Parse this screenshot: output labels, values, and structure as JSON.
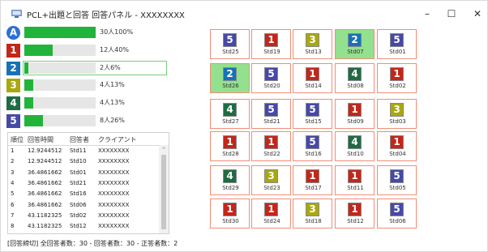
{
  "window": {
    "title": "PCL+出題と回答 回答パネル - XXXXXXXX",
    "controls": {
      "minimize": "–",
      "maximize": "☐",
      "close": "✕"
    }
  },
  "colors": {
    "A": "#2e6fd8",
    "1": "#c3261a",
    "2": "#1672b7",
    "3": "#a8a80f",
    "4": "#1f6b43",
    "5": "#4649a7",
    "bar_fill": "#22b33b",
    "selected_cell": "#93e18e",
    "cell_border": "#f08f78"
  },
  "answers": [
    {
      "label": "A",
      "count_text": "30人100%",
      "percent": 100,
      "circle": true,
      "highlight": false
    },
    {
      "label": "1",
      "count_text": "12人40%",
      "percent": 40,
      "circle": false,
      "highlight": false
    },
    {
      "label": "2",
      "count_text": "2人6%",
      "percent": 6,
      "circle": false,
      "highlight": true
    },
    {
      "label": "3",
      "count_text": "4人13%",
      "percent": 13,
      "circle": false,
      "highlight": false
    },
    {
      "label": "4",
      "count_text": "4人13%",
      "percent": 13,
      "circle": false,
      "highlight": false
    },
    {
      "label": "5",
      "count_text": "8人26%",
      "percent": 26,
      "circle": false,
      "highlight": false
    }
  ],
  "table": {
    "headers": [
      "順位",
      "回答時間",
      "回答者",
      "クライアント"
    ],
    "rows": [
      [
        "1",
        "12.9244512",
        "Std11",
        "XXXXXXXX"
      ],
      [
        "2",
        "12.9244512",
        "Std10",
        "XXXXXXXX"
      ],
      [
        "3",
        "36.4861662",
        "Std01",
        "XXXXXXXX"
      ],
      [
        "4",
        "36.4861662",
        "Std21",
        "XXXXXXXX"
      ],
      [
        "5",
        "36.4861662",
        "Std16",
        "XXXXXXXX"
      ],
      [
        "6",
        "36.4861662",
        "Std06",
        "XXXXXXXX"
      ],
      [
        "7",
        "43.1182325",
        "Std02",
        "XXXXXXXX"
      ],
      [
        "8",
        "43.1182325",
        "Std12",
        "XXXXXXXX"
      ]
    ],
    "scroll_up": "^"
  },
  "status": "[回答締切] 全回答者数：30 - 回答者数：30 - 正答者数：2",
  "grid": [
    [
      {
        "student": "Std25",
        "answer": "5",
        "selected": false
      },
      {
        "student": "Std19",
        "answer": "1",
        "selected": false
      },
      {
        "student": "Std13",
        "answer": "3",
        "selected": false
      },
      {
        "student": "Std07",
        "answer": "2",
        "selected": true
      },
      {
        "student": "Std01",
        "answer": "5",
        "selected": false
      }
    ],
    [
      {
        "student": "Std26",
        "answer": "2",
        "selected": true
      },
      {
        "student": "Std20",
        "answer": "5",
        "selected": false
      },
      {
        "student": "Std14",
        "answer": "1",
        "selected": false
      },
      {
        "student": "Std08",
        "answer": "4",
        "selected": false
      },
      {
        "student": "Std02",
        "answer": "1",
        "selected": false
      }
    ],
    [
      {
        "student": "Std27",
        "answer": "4",
        "selected": false
      },
      {
        "student": "Std21",
        "answer": "5",
        "selected": false
      },
      {
        "student": "Std15",
        "answer": "5",
        "selected": false
      },
      {
        "student": "Std09",
        "answer": "1",
        "selected": false
      },
      {
        "student": "Std03",
        "answer": "3",
        "selected": false
      }
    ],
    [
      {
        "student": "Std28",
        "answer": "1",
        "selected": false
      },
      {
        "student": "Std22",
        "answer": "1",
        "selected": false
      },
      {
        "student": "Std16",
        "answer": "5",
        "selected": false
      },
      {
        "student": "Std10",
        "answer": "4",
        "selected": false
      },
      {
        "student": "Std04",
        "answer": "1",
        "selected": false
      }
    ],
    [
      {
        "student": "Std29",
        "answer": "4",
        "selected": false
      },
      {
        "student": "Std23",
        "answer": "3",
        "selected": false
      },
      {
        "student": "Std17",
        "answer": "1",
        "selected": false
      },
      {
        "student": "Std11",
        "answer": "1",
        "selected": false
      },
      {
        "student": "Std05",
        "answer": "5",
        "selected": false
      }
    ],
    [
      {
        "student": "Std30",
        "answer": "1",
        "selected": false
      },
      {
        "student": "Std24",
        "answer": "1",
        "selected": false
      },
      {
        "student": "Std18",
        "answer": "3",
        "selected": false
      },
      {
        "student": "Std12",
        "answer": "1",
        "selected": false
      },
      {
        "student": "Std06",
        "answer": "5",
        "selected": false
      }
    ]
  ]
}
